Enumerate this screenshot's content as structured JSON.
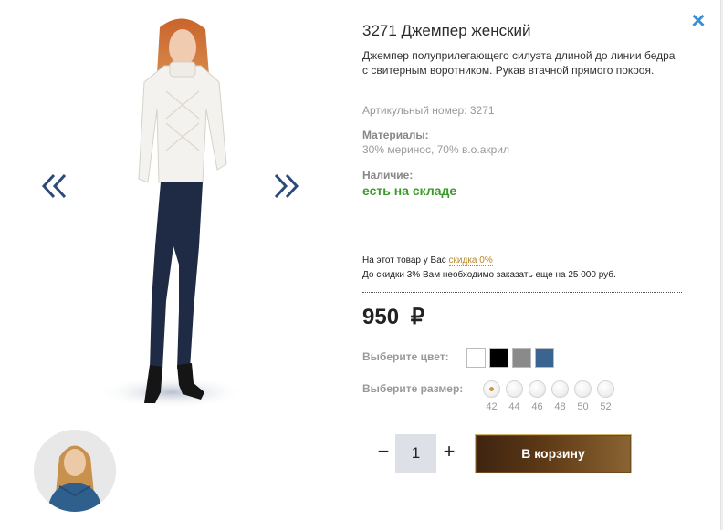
{
  "product": {
    "title": "3271 Джемпер женский",
    "description": "Джемпер полуприлегающего силуэта длиной до линии бедра с свитерным воротником. Рукав втачной прямого покроя.",
    "article": "Артикульный номер: 3271",
    "materials_label": "Материалы:",
    "materials_value": "30% меринос, 70% в.о.акрил",
    "availability_label": "Наличие:",
    "availability_value": "есть на складе"
  },
  "discount": {
    "line1_prefix": "На этот товар у Вас ",
    "line1_link": "скидка 0%",
    "line2": "До скидки 3% Вам необходимо заказать еще на 25 000 руб."
  },
  "price": {
    "amount": "950",
    "currency": "₽"
  },
  "colors": {
    "label": "Выберите цвет:",
    "swatches": [
      {
        "name": "white",
        "hex": "#ffffff"
      },
      {
        "name": "black",
        "hex": "#000000"
      },
      {
        "name": "gray",
        "hex": "#8a8a8a"
      },
      {
        "name": "blue",
        "hex": "#3b6591"
      }
    ]
  },
  "sizes": {
    "label": "Выберите размер:",
    "options": [
      "42",
      "44",
      "46",
      "48",
      "50",
      "52"
    ],
    "selected": "42"
  },
  "quantity": {
    "minus": "−",
    "value": "1",
    "plus": "+"
  },
  "cart": {
    "button_label": "В корзину"
  },
  "icons": {
    "close": "close-icon",
    "prev": "chevron-double-left-icon",
    "next": "chevron-double-right-icon"
  },
  "colors_theme": {
    "accent_link": "#b8862a",
    "available_green": "#3a9a2a",
    "close_blue": "#3a8ed6",
    "arrow_navy": "#2d4a78"
  }
}
